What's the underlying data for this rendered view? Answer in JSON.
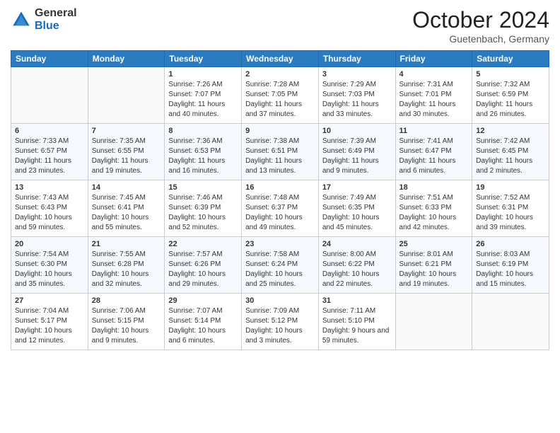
{
  "header": {
    "logo_general": "General",
    "logo_blue": "Blue",
    "month": "October 2024",
    "location": "Guetenbach, Germany"
  },
  "weekdays": [
    "Sunday",
    "Monday",
    "Tuesday",
    "Wednesday",
    "Thursday",
    "Friday",
    "Saturday"
  ],
  "weeks": [
    [
      {
        "day": "",
        "sunrise": "",
        "sunset": "",
        "daylight": ""
      },
      {
        "day": "",
        "sunrise": "",
        "sunset": "",
        "daylight": ""
      },
      {
        "day": "1",
        "sunrise": "Sunrise: 7:26 AM",
        "sunset": "Sunset: 7:07 PM",
        "daylight": "Daylight: 11 hours and 40 minutes."
      },
      {
        "day": "2",
        "sunrise": "Sunrise: 7:28 AM",
        "sunset": "Sunset: 7:05 PM",
        "daylight": "Daylight: 11 hours and 37 minutes."
      },
      {
        "day": "3",
        "sunrise": "Sunrise: 7:29 AM",
        "sunset": "Sunset: 7:03 PM",
        "daylight": "Daylight: 11 hours and 33 minutes."
      },
      {
        "day": "4",
        "sunrise": "Sunrise: 7:31 AM",
        "sunset": "Sunset: 7:01 PM",
        "daylight": "Daylight: 11 hours and 30 minutes."
      },
      {
        "day": "5",
        "sunrise": "Sunrise: 7:32 AM",
        "sunset": "Sunset: 6:59 PM",
        "daylight": "Daylight: 11 hours and 26 minutes."
      }
    ],
    [
      {
        "day": "6",
        "sunrise": "Sunrise: 7:33 AM",
        "sunset": "Sunset: 6:57 PM",
        "daylight": "Daylight: 11 hours and 23 minutes."
      },
      {
        "day": "7",
        "sunrise": "Sunrise: 7:35 AM",
        "sunset": "Sunset: 6:55 PM",
        "daylight": "Daylight: 11 hours and 19 minutes."
      },
      {
        "day": "8",
        "sunrise": "Sunrise: 7:36 AM",
        "sunset": "Sunset: 6:53 PM",
        "daylight": "Daylight: 11 hours and 16 minutes."
      },
      {
        "day": "9",
        "sunrise": "Sunrise: 7:38 AM",
        "sunset": "Sunset: 6:51 PM",
        "daylight": "Daylight: 11 hours and 13 minutes."
      },
      {
        "day": "10",
        "sunrise": "Sunrise: 7:39 AM",
        "sunset": "Sunset: 6:49 PM",
        "daylight": "Daylight: 11 hours and 9 minutes."
      },
      {
        "day": "11",
        "sunrise": "Sunrise: 7:41 AM",
        "sunset": "Sunset: 6:47 PM",
        "daylight": "Daylight: 11 hours and 6 minutes."
      },
      {
        "day": "12",
        "sunrise": "Sunrise: 7:42 AM",
        "sunset": "Sunset: 6:45 PM",
        "daylight": "Daylight: 11 hours and 2 minutes."
      }
    ],
    [
      {
        "day": "13",
        "sunrise": "Sunrise: 7:43 AM",
        "sunset": "Sunset: 6:43 PM",
        "daylight": "Daylight: 10 hours and 59 minutes."
      },
      {
        "day": "14",
        "sunrise": "Sunrise: 7:45 AM",
        "sunset": "Sunset: 6:41 PM",
        "daylight": "Daylight: 10 hours and 55 minutes."
      },
      {
        "day": "15",
        "sunrise": "Sunrise: 7:46 AM",
        "sunset": "Sunset: 6:39 PM",
        "daylight": "Daylight: 10 hours and 52 minutes."
      },
      {
        "day": "16",
        "sunrise": "Sunrise: 7:48 AM",
        "sunset": "Sunset: 6:37 PM",
        "daylight": "Daylight: 10 hours and 49 minutes."
      },
      {
        "day": "17",
        "sunrise": "Sunrise: 7:49 AM",
        "sunset": "Sunset: 6:35 PM",
        "daylight": "Daylight: 10 hours and 45 minutes."
      },
      {
        "day": "18",
        "sunrise": "Sunrise: 7:51 AM",
        "sunset": "Sunset: 6:33 PM",
        "daylight": "Daylight: 10 hours and 42 minutes."
      },
      {
        "day": "19",
        "sunrise": "Sunrise: 7:52 AM",
        "sunset": "Sunset: 6:31 PM",
        "daylight": "Daylight: 10 hours and 39 minutes."
      }
    ],
    [
      {
        "day": "20",
        "sunrise": "Sunrise: 7:54 AM",
        "sunset": "Sunset: 6:30 PM",
        "daylight": "Daylight: 10 hours and 35 minutes."
      },
      {
        "day": "21",
        "sunrise": "Sunrise: 7:55 AM",
        "sunset": "Sunset: 6:28 PM",
        "daylight": "Daylight: 10 hours and 32 minutes."
      },
      {
        "day": "22",
        "sunrise": "Sunrise: 7:57 AM",
        "sunset": "Sunset: 6:26 PM",
        "daylight": "Daylight: 10 hours and 29 minutes."
      },
      {
        "day": "23",
        "sunrise": "Sunrise: 7:58 AM",
        "sunset": "Sunset: 6:24 PM",
        "daylight": "Daylight: 10 hours and 25 minutes."
      },
      {
        "day": "24",
        "sunrise": "Sunrise: 8:00 AM",
        "sunset": "Sunset: 6:22 PM",
        "daylight": "Daylight: 10 hours and 22 minutes."
      },
      {
        "day": "25",
        "sunrise": "Sunrise: 8:01 AM",
        "sunset": "Sunset: 6:21 PM",
        "daylight": "Daylight: 10 hours and 19 minutes."
      },
      {
        "day": "26",
        "sunrise": "Sunrise: 8:03 AM",
        "sunset": "Sunset: 6:19 PM",
        "daylight": "Daylight: 10 hours and 15 minutes."
      }
    ],
    [
      {
        "day": "27",
        "sunrise": "Sunrise: 7:04 AM",
        "sunset": "Sunset: 5:17 PM",
        "daylight": "Daylight: 10 hours and 12 minutes."
      },
      {
        "day": "28",
        "sunrise": "Sunrise: 7:06 AM",
        "sunset": "Sunset: 5:15 PM",
        "daylight": "Daylight: 10 hours and 9 minutes."
      },
      {
        "day": "29",
        "sunrise": "Sunrise: 7:07 AM",
        "sunset": "Sunset: 5:14 PM",
        "daylight": "Daylight: 10 hours and 6 minutes."
      },
      {
        "day": "30",
        "sunrise": "Sunrise: 7:09 AM",
        "sunset": "Sunset: 5:12 PM",
        "daylight": "Daylight: 10 hours and 3 minutes."
      },
      {
        "day": "31",
        "sunrise": "Sunrise: 7:11 AM",
        "sunset": "Sunset: 5:10 PM",
        "daylight": "Daylight: 9 hours and 59 minutes."
      },
      {
        "day": "",
        "sunrise": "",
        "sunset": "",
        "daylight": ""
      },
      {
        "day": "",
        "sunrise": "",
        "sunset": "",
        "daylight": ""
      }
    ]
  ]
}
